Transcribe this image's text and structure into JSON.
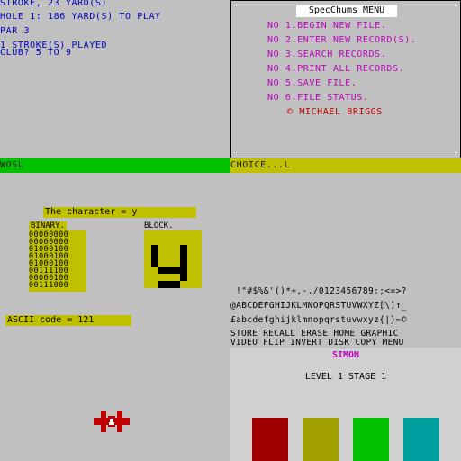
{
  "golf": {
    "lines": [
      "STROKE, 23 YARD(S)",
      "HOLE 1: 186 YARD(S) TO PLAY",
      "PAR 3",
      "1 STROKE(S) PLAYED",
      "CLUB? 5 TO 9"
    ],
    "input_bar": "WOSL"
  },
  "specchums": {
    "title": "SpecChums MENU",
    "items": [
      "NO 1.BEGIN NEW FILE.",
      "NO 2.ENTER NEW RECORD(S).",
      "NO 3.SEARCH RECORDS.",
      "NO 4.PRINT ALL RECORDS.",
      "NO 5.SAVE FILE.",
      "NO 6.FILE STATUS."
    ],
    "credit": "© MICHAEL BRIGGS",
    "choice_bar": "CHOICE...L"
  },
  "charview": {
    "title": "The character = y",
    "binary_label": "BINARY.",
    "block_label": "BLOCK.",
    "binary_rows": [
      "00000000",
      "00000000",
      "01000100",
      "01000100",
      "01000100",
      "00111100",
      "00000100",
      "00111000"
    ],
    "ascii_code": "ASCII code = 121",
    "ship_icon": "ship-icon"
  },
  "charset": {
    "lines": [
      " !\"#$%&'()*+,-./0123456789:;<=>?",
      "@ABCDEFGHIJKLMNOPQRSTUVWXYZ[\\]↑_",
      "£abcdefghijklmnopqrstuvwxyz{|}~©"
    ]
  },
  "editor_menu": {
    "line1": "STORE RECALL ERASE HOME GRAPHIC",
    "line2": "VIDEO FLIP INVERT DISK COPY MENU"
  },
  "simon": {
    "title": "SIMON",
    "level": "LEVEL 1 STAGE 1",
    "pad_colors": [
      "#a00000",
      "#a0a000",
      "#00c000",
      "#00a0a0"
    ]
  }
}
